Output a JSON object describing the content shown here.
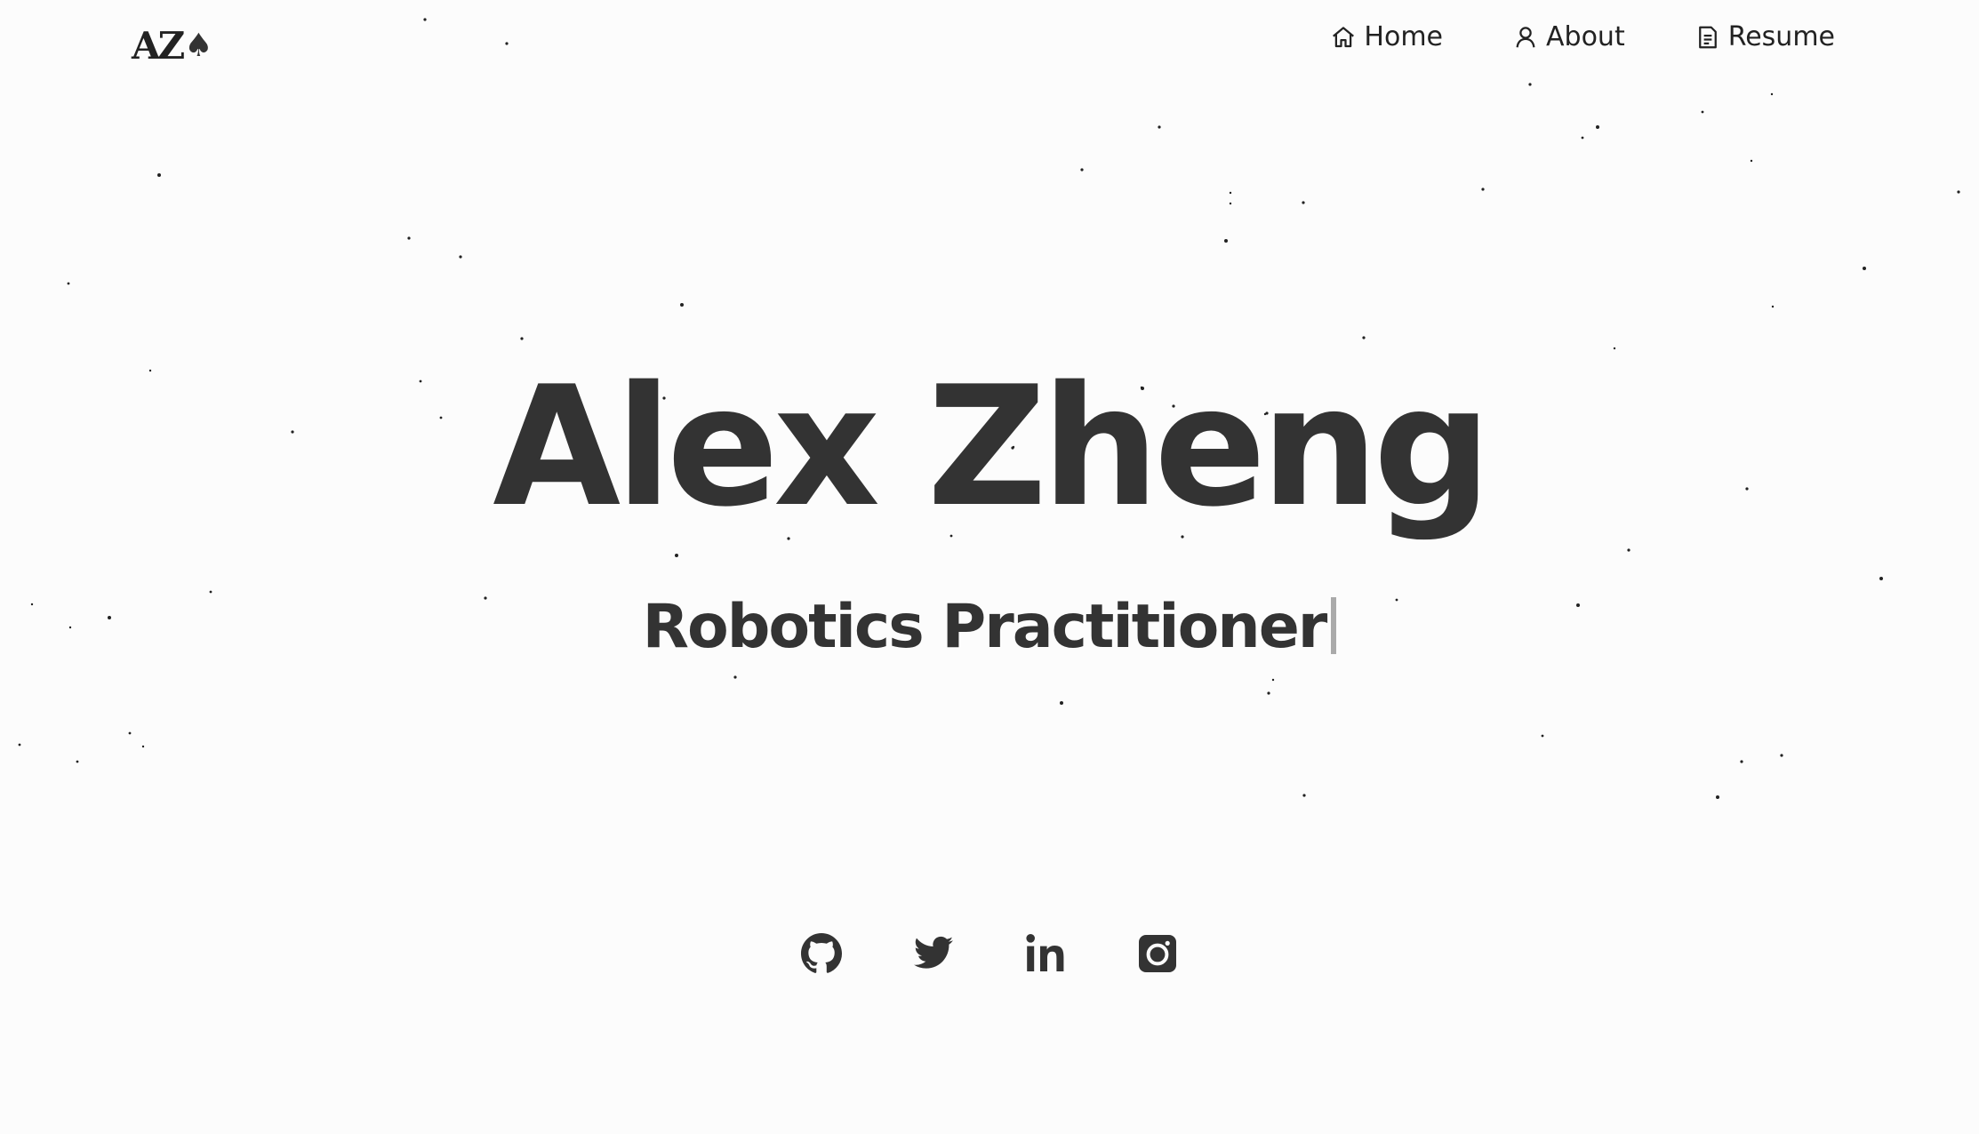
{
  "header": {
    "logo_text": "AZ",
    "nav": [
      {
        "label": "Home",
        "icon": "home-icon"
      },
      {
        "label": "About",
        "icon": "user-icon"
      },
      {
        "label": "Resume",
        "icon": "document-icon"
      }
    ]
  },
  "hero": {
    "name": "Alex Zheng",
    "subtitle": "Robotics Practitioner"
  },
  "socials": [
    {
      "name": "github",
      "icon": "github-icon"
    },
    {
      "name": "twitter",
      "icon": "twitter-icon"
    },
    {
      "name": "linkedin",
      "icon": "linkedin-icon"
    },
    {
      "name": "instagram",
      "icon": "instagram-icon"
    }
  ],
  "colors": {
    "background": "#fcfcfc",
    "text": "#333333",
    "cursor": "#aaaaaa",
    "star": "#222222"
  }
}
